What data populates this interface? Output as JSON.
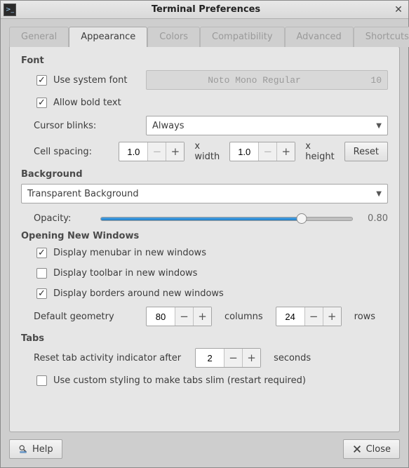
{
  "window": {
    "title": "Terminal Preferences"
  },
  "tabs": [
    {
      "label": "General"
    },
    {
      "label": "Appearance"
    },
    {
      "label": "Colors"
    },
    {
      "label": "Compatibility"
    },
    {
      "label": "Advanced"
    },
    {
      "label": "Shortcuts"
    }
  ],
  "font": {
    "heading": "Font",
    "use_system_font_label": "Use system font",
    "use_system_font_checked": true,
    "font_name": "Noto Mono Regular",
    "font_size": "10",
    "allow_bold_label": "Allow bold text",
    "allow_bold_checked": true,
    "cursor_blinks_label": "Cursor blinks:",
    "cursor_blinks_value": "Always",
    "cell_spacing_label": "Cell spacing:",
    "cell_width_value": "1.0",
    "x_width_label": "x width",
    "cell_height_value": "1.0",
    "x_height_label": "x height",
    "reset_label": "Reset"
  },
  "background": {
    "heading": "Background",
    "mode_value": "Transparent Background",
    "opacity_label": "Opacity:",
    "opacity_value": "0.80",
    "opacity_fraction": 0.8
  },
  "new_windows": {
    "heading": "Opening New Windows",
    "display_menubar_label": "Display menubar in new windows",
    "display_menubar_checked": true,
    "display_toolbar_label": "Display toolbar in new windows",
    "display_toolbar_checked": false,
    "display_borders_label": "Display borders around new windows",
    "display_borders_checked": true,
    "default_geometry_label": "Default geometry",
    "columns_value": "80",
    "columns_label": "columns",
    "rows_value": "24",
    "rows_label": "rows"
  },
  "tabs_section": {
    "heading": "Tabs",
    "reset_activity_label": "Reset tab activity indicator after",
    "reset_activity_value": "2",
    "seconds_label": "seconds",
    "slim_tabs_label": "Use custom styling to make tabs slim (restart required)",
    "slim_tabs_checked": false
  },
  "footer": {
    "help_label": "Help",
    "close_label": "Close"
  }
}
